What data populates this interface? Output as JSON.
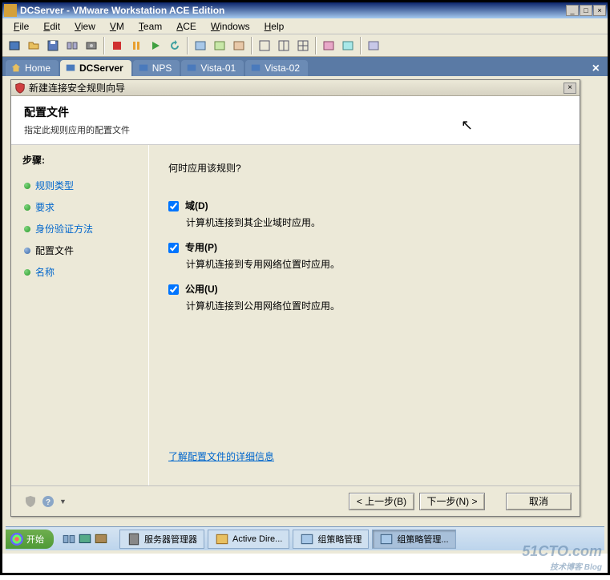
{
  "window": {
    "title": "DCServer - VMware Workstation ACE Edition",
    "buttons": {
      "min": "_",
      "max": "□",
      "close": "×"
    }
  },
  "menu": [
    "File",
    "Edit",
    "View",
    "VM",
    "Team",
    "ACE",
    "Windows",
    "Help"
  ],
  "tabs": {
    "home": "Home",
    "items": [
      {
        "label": "DCServer",
        "active": true
      },
      {
        "label": "NPS",
        "active": false
      },
      {
        "label": "Vista-01",
        "active": false
      },
      {
        "label": "Vista-02",
        "active": false
      }
    ],
    "close": "×"
  },
  "dialog": {
    "title": "新建连接安全规则向导",
    "close": "×",
    "header_title": "配置文件",
    "header_sub": "指定此规则应用的配置文件",
    "steps_label": "步骤:",
    "steps": [
      {
        "label": "规则类型",
        "active": false
      },
      {
        "label": "要求",
        "active": false
      },
      {
        "label": "身份验证方法",
        "active": false
      },
      {
        "label": "配置文件",
        "active": true
      },
      {
        "label": "名称",
        "active": false
      }
    ],
    "prompt": "何时应用该规则?",
    "options": [
      {
        "label": "域(D)",
        "desc": "计算机连接到其企业域时应用。",
        "checked": true
      },
      {
        "label": "专用(P)",
        "desc": "计算机连接到专用网络位置时应用。",
        "checked": true
      },
      {
        "label": "公用(U)",
        "desc": "计算机连接到公用网络位置时应用。",
        "checked": true
      }
    ],
    "link": "了解配置文件的详细信息",
    "buttons": {
      "back": "< 上一步(B)",
      "next": "下一步(N) >",
      "cancel": "取消"
    }
  },
  "taskbar": {
    "start": "开始",
    "tasks": [
      {
        "label": "服务器管理器",
        "active": false
      },
      {
        "label": "Active Dire...",
        "active": false
      },
      {
        "label": "组策略管理",
        "active": false
      },
      {
        "label": "组策略管理...",
        "active": true
      }
    ]
  },
  "watermark": {
    "main": "51CTO.com",
    "sub": "技术博客 Blog"
  }
}
